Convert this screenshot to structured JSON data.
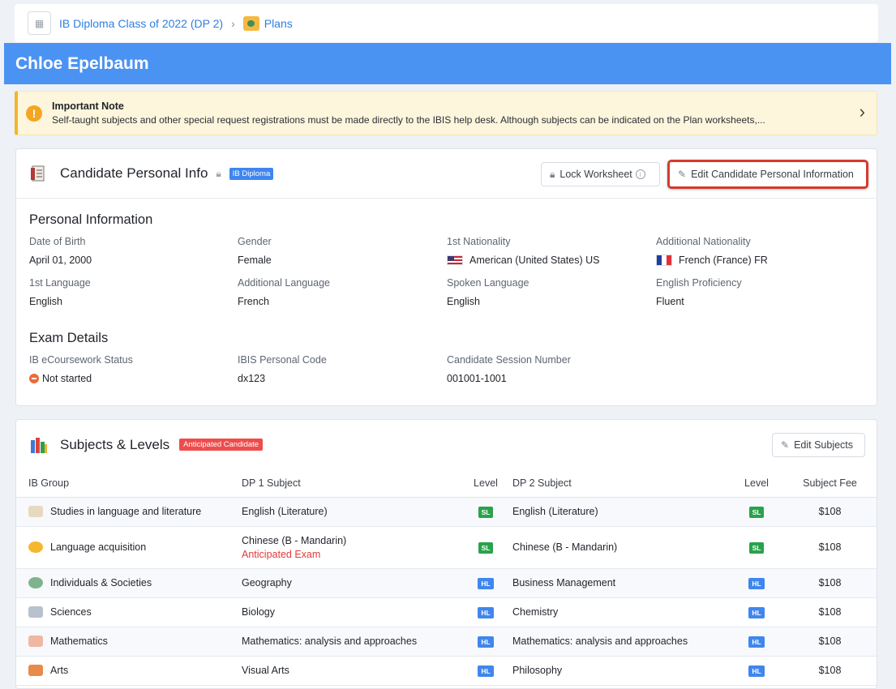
{
  "breadcrumb": {
    "class": "IB Diploma Class of 2022 (DP 2)",
    "sep": "›",
    "plans": "Plans"
  },
  "header": {
    "title": "Chloe Epelbaum"
  },
  "note": {
    "title": "Important Note",
    "body": "Self-taught subjects and other special request registrations must be made directly to the IBIS help desk. Although subjects can be indicated on the Plan worksheets,..."
  },
  "candidate_card": {
    "title": "Candidate Personal Info",
    "badge": "IB Diploma",
    "lock_button": "Lock Worksheet",
    "edit_button": "Edit Candidate Personal Information",
    "personal_title": "Personal Information",
    "fields": [
      {
        "label": "Date of Birth",
        "value": "April 01, 2000"
      },
      {
        "label": "Gender",
        "value": "Female"
      },
      {
        "label": "1st Nationality",
        "value": "American (United States) US"
      },
      {
        "label": "Additional Nationality",
        "value": "French (France) FR"
      },
      {
        "label": "1st Language",
        "value": "English"
      },
      {
        "label": "Additional Language",
        "value": "French"
      },
      {
        "label": "Spoken Language",
        "value": "English"
      },
      {
        "label": "English Proficiency",
        "value": "Fluent"
      }
    ],
    "exam_title": "Exam Details",
    "exam_fields": [
      {
        "label": "IB eCoursework Status",
        "value": "Not started"
      },
      {
        "label": "IBIS Personal Code",
        "value": "dx123"
      },
      {
        "label": "Candidate Session Number",
        "value": "001001-1001"
      }
    ]
  },
  "subjects_card": {
    "title": "Subjects & Levels",
    "badge": "Anticipated Candidate",
    "edit_button": "Edit Subjects",
    "columns": [
      "IB Group",
      "DP 1 Subject",
      "Level",
      "DP 2 Subject",
      "Level",
      "Subject Fee"
    ],
    "rows": [
      {
        "group": "Studies in language and literature",
        "dp1": "English (Literature)",
        "l1": "SL",
        "dp2": "English (Literature)",
        "l2": "SL",
        "fee": "$108"
      },
      {
        "group": "Language acquisition",
        "dp1": "Chinese (B - Mandarin)",
        "dp1_note": "Anticipated Exam",
        "l1": "SL",
        "dp2": "Chinese (B - Mandarin)",
        "l2": "SL",
        "fee": "$108"
      },
      {
        "group": "Individuals & Societies",
        "dp1": "Geography",
        "l1": "HL",
        "dp2": "Business Management",
        "l2": "HL",
        "fee": "$108"
      },
      {
        "group": "Sciences",
        "dp1": "Biology",
        "l1": "HL",
        "dp2": "Chemistry",
        "l2": "HL",
        "fee": "$108"
      },
      {
        "group": "Mathematics",
        "dp1": "Mathematics: analysis and approaches",
        "l1": "HL",
        "dp2": "Mathematics: analysis and approaches",
        "l2": "HL",
        "fee": "$108"
      },
      {
        "group": "Arts",
        "dp1": "Visual Arts",
        "l1": "HL",
        "dp2": "Philosophy",
        "l2": "HL",
        "fee": "$108"
      }
    ]
  }
}
